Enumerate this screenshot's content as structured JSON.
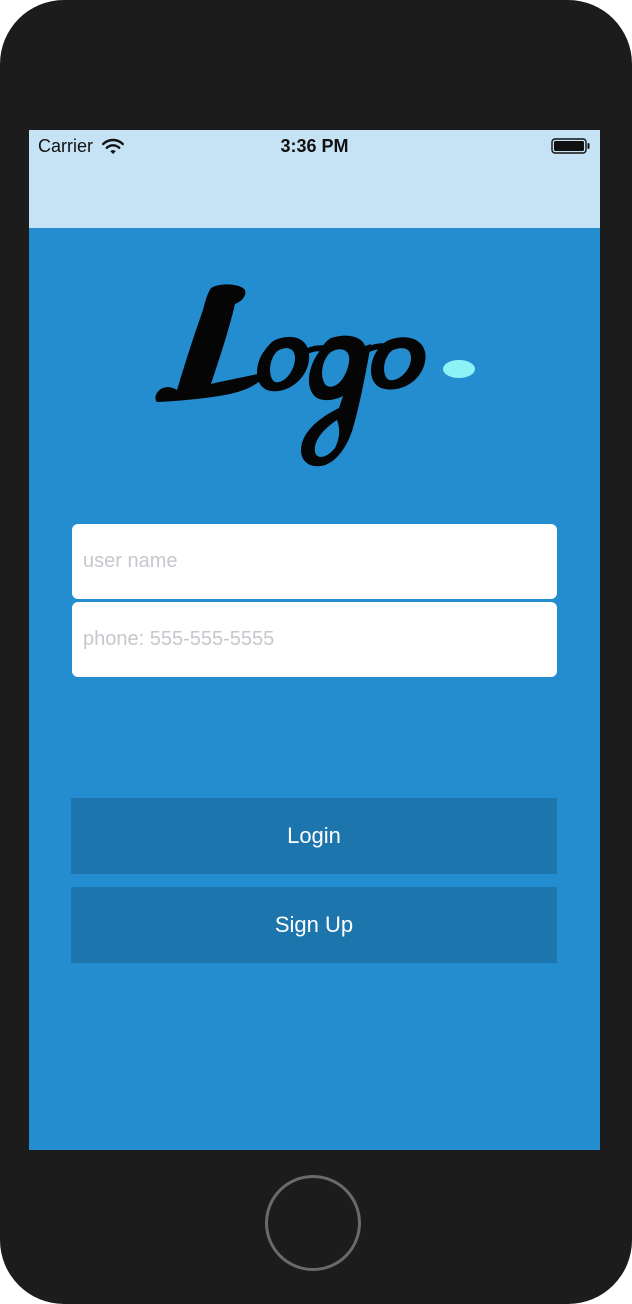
{
  "status_bar": {
    "carrier": "Carrier",
    "time": "3:36 PM",
    "icons": [
      "wifi-icon",
      "battery-icon"
    ]
  },
  "logo": {
    "text": "Logo",
    "dot_color": "#8ef3f7"
  },
  "form": {
    "username_placeholder": "user name",
    "username_value": "",
    "phone_placeholder": "phone: 555-555-5555",
    "phone_value": ""
  },
  "buttons": {
    "login_label": "Login",
    "signup_label": "Sign Up"
  },
  "colors": {
    "background": "#248dcf",
    "status_bar": "#c6e3f5",
    "button": "#1d75ad",
    "device_frame": "#1c1c1c"
  }
}
